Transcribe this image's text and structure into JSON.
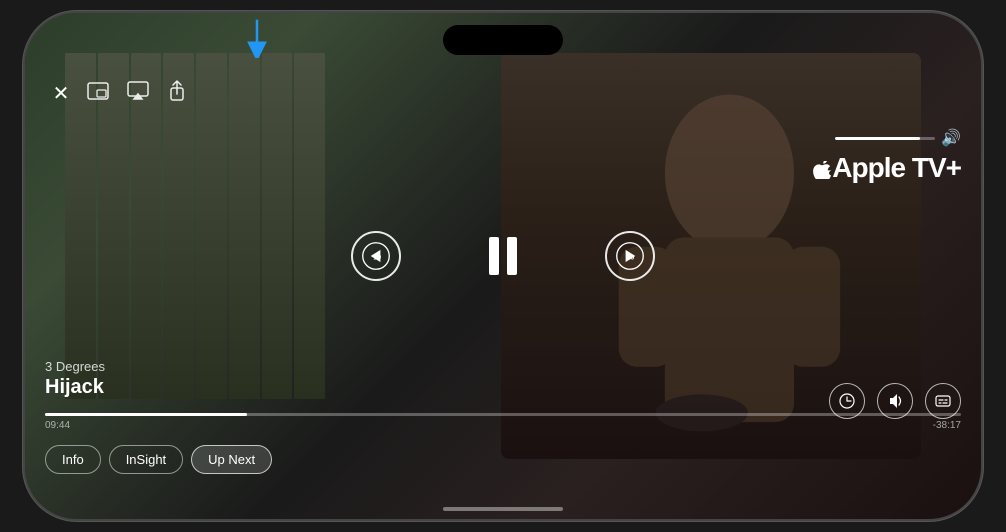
{
  "app": {
    "title": "Apple TV+"
  },
  "phone": {
    "border_color": "#444"
  },
  "arrow": {
    "color": "#2196f3"
  },
  "video": {
    "show_name": "3 Degrees",
    "episode_title": "Hijack",
    "time_elapsed": "09:44",
    "time_remaining": "-38:17",
    "progress_percent": 22
  },
  "controls": {
    "close_label": "✕",
    "rewind_label": "10",
    "forward_label": "10",
    "pause_label": "pause",
    "volume_level": 85
  },
  "tabs": [
    {
      "id": "info",
      "label": "Info",
      "active": false
    },
    {
      "id": "insight",
      "label": "InSight",
      "active": false
    },
    {
      "id": "up-next",
      "label": "Up Next",
      "active": false
    }
  ],
  "top_icons": [
    {
      "id": "miniplayer",
      "symbol": "⊡"
    },
    {
      "id": "airplay",
      "symbol": "⬛"
    },
    {
      "id": "share",
      "symbol": "⬆"
    }
  ],
  "right_controls": [
    {
      "id": "speed",
      "symbol": "⏱"
    },
    {
      "id": "audio",
      "symbol": "🔊"
    },
    {
      "id": "subtitles",
      "symbol": "💬"
    }
  ],
  "brand": {
    "apple_symbol": "",
    "tv_label": "tv+",
    "full_label": " tv+"
  }
}
